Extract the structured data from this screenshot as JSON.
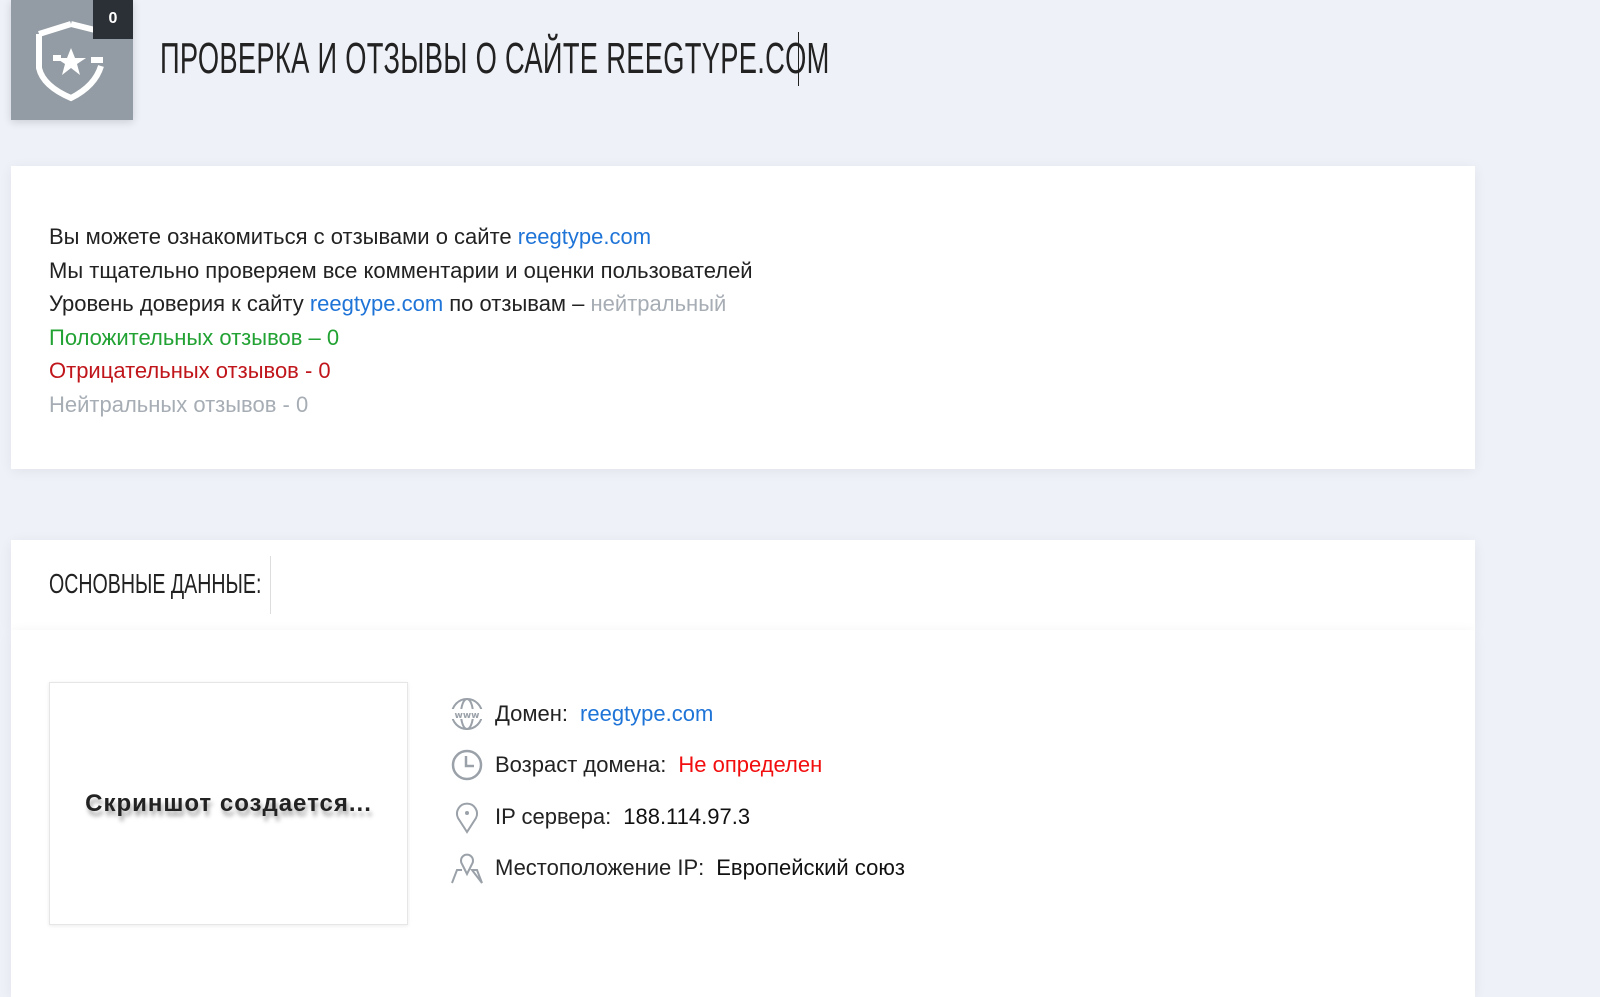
{
  "header": {
    "badge_count": "0",
    "title": "ПРОВЕРКА И ОТЗЫВЫ О САЙТЕ REEGTYPE.COM"
  },
  "intro": {
    "line1_prefix": "Вы можете ознакомиться с отзывами о сайте ",
    "domain": "reegtype.com",
    "line2": "Мы тщательно проверяем все комментарии и оценки пользователей",
    "line3_prefix": "Уровень доверия к сайту ",
    "line3_middle": " по отзывам – ",
    "trust_level": "нейтральный",
    "positive": "Положительных отзывов – 0",
    "negative": "Отрицательных отзывов - 0",
    "neutral": "Нейтральных отзывов - 0"
  },
  "main_data": {
    "heading": "ОСНОВНЫЕ ДАННЫЕ:",
    "screenshot_text": "Скриншот создается...",
    "rows": [
      {
        "icon": "www-globe-icon",
        "label": "Домен:",
        "value": "reegtype.com"
      },
      {
        "icon": "clock-icon",
        "label": "Возраст домена:",
        "value": "Не определен"
      },
      {
        "icon": "map-pin-icon",
        "label": "IP сервера:",
        "value": "188.114.97.3"
      },
      {
        "icon": "map-location-icon",
        "label": "Местоположение IP:",
        "value": "Европейский союз"
      }
    ]
  },
  "colors": {
    "link": "#1f74d8",
    "positive": "#22a233",
    "negative": "#c0161b",
    "neutral": "#a6adb4"
  }
}
